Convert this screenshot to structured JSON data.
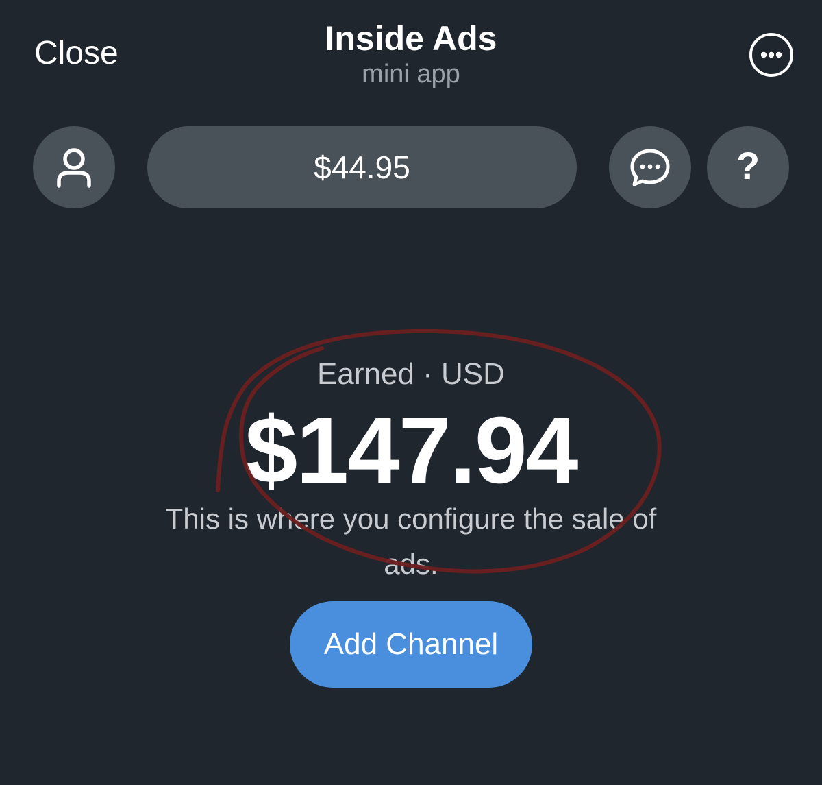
{
  "header": {
    "close_label": "Close",
    "title": "Inside Ads",
    "subtitle": "mini app",
    "more_icon": "more-horizontal-icon"
  },
  "toolbar": {
    "profile_icon": "user-icon",
    "balance": "$44.95",
    "chat_icon": "chat-bubble-icon",
    "help_icon": "question-mark-icon"
  },
  "main": {
    "earned_label": "Earned · USD",
    "earned_amount": "$147.94",
    "description": "This is where you configure the sale of ads.",
    "add_channel_label": "Add Channel"
  },
  "colors": {
    "background": "#1f262e",
    "button_gray": "#4a5259",
    "accent_blue": "#4a8ede",
    "annotation_red": "#6b1f1f"
  }
}
